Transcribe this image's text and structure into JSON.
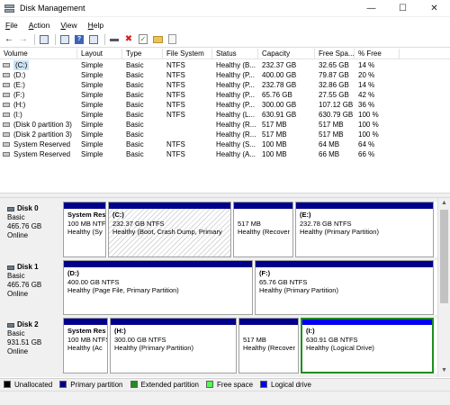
{
  "window": {
    "title": "Disk Management"
  },
  "menu": [
    {
      "label": "File",
      "key": "F"
    },
    {
      "label": "Action",
      "key": "A"
    },
    {
      "label": "View",
      "key": "V"
    },
    {
      "label": "Help",
      "key": "H"
    }
  ],
  "table": {
    "headers": [
      "Volume",
      "Layout",
      "Type",
      "File System",
      "Status",
      "Capacity",
      "Free Spa...",
      "% Free"
    ],
    "rows": [
      {
        "volume": "(C:)",
        "layout": "Simple",
        "type": "Basic",
        "fs": "NTFS",
        "status": "Healthy (B...",
        "capacity": "232.37 GB",
        "free": "32.65 GB",
        "pct": "14 %"
      },
      {
        "volume": "(D:)",
        "layout": "Simple",
        "type": "Basic",
        "fs": "NTFS",
        "status": "Healthy (P...",
        "capacity": "400.00 GB",
        "free": "79.87 GB",
        "pct": "20 %"
      },
      {
        "volume": "(E:)",
        "layout": "Simple",
        "type": "Basic",
        "fs": "NTFS",
        "status": "Healthy (P...",
        "capacity": "232.78 GB",
        "free": "32.86 GB",
        "pct": "14 %"
      },
      {
        "volume": "(F:)",
        "layout": "Simple",
        "type": "Basic",
        "fs": "NTFS",
        "status": "Healthy (P...",
        "capacity": "65.76 GB",
        "free": "27.55 GB",
        "pct": "42 %"
      },
      {
        "volume": "(H:)",
        "layout": "Simple",
        "type": "Basic",
        "fs": "NTFS",
        "status": "Healthy (P...",
        "capacity": "300.00 GB",
        "free": "107.12 GB",
        "pct": "36 %"
      },
      {
        "volume": "(I:)",
        "layout": "Simple",
        "type": "Basic",
        "fs": "NTFS",
        "status": "Healthy (L...",
        "capacity": "630.91 GB",
        "free": "630.79 GB",
        "pct": "100 %"
      },
      {
        "volume": "(Disk 0 partition 3)",
        "layout": "Simple",
        "type": "Basic",
        "fs": "",
        "status": "Healthy (R...",
        "capacity": "517 MB",
        "free": "517 MB",
        "pct": "100 %"
      },
      {
        "volume": "(Disk 2 partition 3)",
        "layout": "Simple",
        "type": "Basic",
        "fs": "",
        "status": "Healthy (R...",
        "capacity": "517 MB",
        "free": "517 MB",
        "pct": "100 %"
      },
      {
        "volume": "System Reserved",
        "layout": "Simple",
        "type": "Basic",
        "fs": "NTFS",
        "status": "Healthy (S...",
        "capacity": "100 MB",
        "free": "64 MB",
        "pct": "64 %"
      },
      {
        "volume": "System Reserved",
        "layout": "Simple",
        "type": "Basic",
        "fs": "NTFS",
        "status": "Healthy (A...",
        "capacity": "100 MB",
        "free": "66 MB",
        "pct": "66 %"
      }
    ]
  },
  "disks": [
    {
      "name": "Disk 0",
      "kind": "Basic",
      "size": "465.76 GB",
      "state": "Online",
      "partitions": [
        {
          "name": "System Res",
          "size": "100 MB NTFS",
          "status": "Healthy (Sy",
          "style": "primary"
        },
        {
          "name": "(C:)",
          "size": "232.37 GB NTFS",
          "status": "Healthy (Boot, Crash Dump, Primary",
          "style": "hatch"
        },
        {
          "name": "",
          "size": "517 MB",
          "status": "Healthy (Recover",
          "style": "primary"
        },
        {
          "name": "(E:)",
          "size": "232.78 GB NTFS",
          "status": "Healthy (Primary Partition)",
          "style": "primary"
        }
      ]
    },
    {
      "name": "Disk 1",
      "kind": "Basic",
      "size": "465.76 GB",
      "state": "Online",
      "partitions": [
        {
          "name": "(D:)",
          "size": "400.00 GB NTFS",
          "status": "Healthy (Page File, Primary Partition)",
          "style": "primary"
        },
        {
          "name": "(F:)",
          "size": "65.76 GB NTFS",
          "status": "Healthy (Primary Partition)",
          "style": "primary"
        }
      ]
    },
    {
      "name": "Disk 2",
      "kind": "Basic",
      "size": "931.51 GB",
      "state": "Online",
      "partitions": [
        {
          "name": "System Res",
          "size": "100 MB NTFS",
          "status": "Healthy (Ac",
          "style": "primary"
        },
        {
          "name": "(H:)",
          "size": "300.00 GB NTFS",
          "status": "Healthy (Primary Partition)",
          "style": "primary"
        },
        {
          "name": "",
          "size": "517 MB",
          "status": "Healthy (Recover",
          "style": "primary"
        },
        {
          "name": "(I:)",
          "size": "630.91 GB NTFS",
          "status": "Healthy (Logical Drive)",
          "style": "logical"
        }
      ]
    }
  ],
  "legend": [
    {
      "label": "Unallocated",
      "color": "#000000"
    },
    {
      "label": "Primary partition",
      "color": "#00008b"
    },
    {
      "label": "Extended partition",
      "color": "#1e8f1e"
    },
    {
      "label": "Free space",
      "color": "#4cff4c"
    },
    {
      "label": "Logical drive",
      "color": "#0000ee"
    }
  ],
  "icons": [
    "back-arrow-icon",
    "forward-arrow-icon",
    "console-tree-icon",
    "properties-icon",
    "help-icon",
    "list-view-icon",
    "connect-icon",
    "delete-icon",
    "check-icon",
    "folder-icon",
    "document-icon"
  ]
}
